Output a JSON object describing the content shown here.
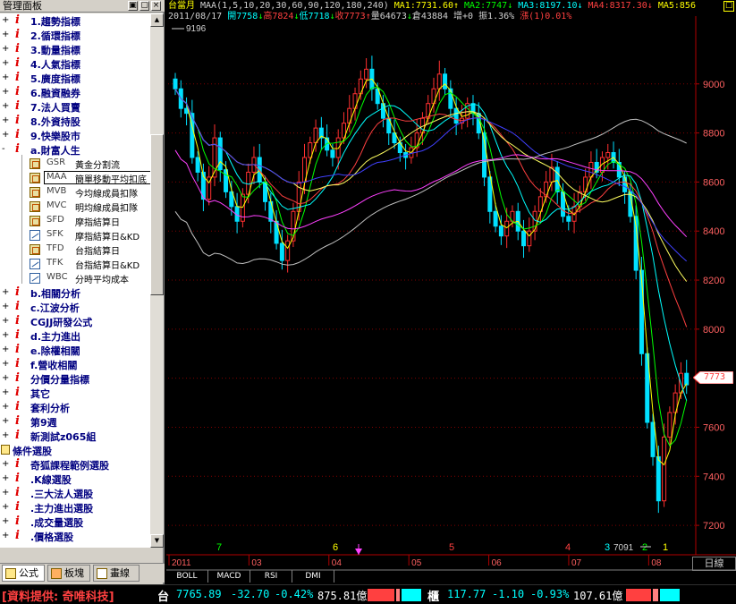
{
  "panel": {
    "title": "管理面板",
    "buttons": [
      "▣",
      "▢",
      "×"
    ],
    "items": [
      {
        "label": "1.趨勢指標",
        "kind": "i"
      },
      {
        "label": "2.循環指標",
        "kind": "i"
      },
      {
        "label": "3.動量指標",
        "kind": "i"
      },
      {
        "label": "4.人氣指標",
        "kind": "i"
      },
      {
        "label": "5.廣度指標",
        "kind": "i"
      },
      {
        "label": "6.融資融券",
        "kind": "i"
      },
      {
        "label": "7.法人買賣",
        "kind": "i"
      },
      {
        "label": "8.外資持股",
        "kind": "i"
      },
      {
        "label": "9.快樂股市",
        "kind": "i"
      },
      {
        "label": "a.財富人生",
        "kind": "i",
        "expanded": true
      },
      {
        "code": "GSR",
        "name": "黃金分割流",
        "kind": "sub",
        "icon": "formula"
      },
      {
        "code": "MAA",
        "name": "簡單移動平均扣底",
        "kind": "sub",
        "icon": "formula",
        "selected": true
      },
      {
        "code": "MVB",
        "name": "今均線成員扣隊",
        "kind": "sub",
        "icon": "formula"
      },
      {
        "code": "MVC",
        "name": "明均線成員扣隊",
        "kind": "sub",
        "icon": "formula"
      },
      {
        "code": "SFD",
        "name": "摩指結算日",
        "kind": "sub",
        "icon": "formula"
      },
      {
        "code": "SFK",
        "name": "摩指結算日&KD",
        "kind": "sub",
        "icon": "line"
      },
      {
        "code": "TFD",
        "name": "台指結算日",
        "kind": "sub",
        "icon": "formula"
      },
      {
        "code": "TFK",
        "name": "台指結算日&KD",
        "kind": "sub",
        "icon": "line"
      },
      {
        "code": "WBC",
        "name": "分時平均成本",
        "kind": "sub",
        "icon": "line"
      },
      {
        "label": "b.相關分析",
        "kind": "i"
      },
      {
        "label": "c.江波分析",
        "kind": "i"
      },
      {
        "label": "CGJJ研發公式",
        "kind": "i"
      },
      {
        "label": "d.主力進出",
        "kind": "i"
      },
      {
        "label": "e.除權相關",
        "kind": "i"
      },
      {
        "label": "f.營收相關",
        "kind": "i"
      },
      {
        "label": "分價分量指標",
        "kind": "i"
      },
      {
        "label": "其它",
        "kind": "i"
      },
      {
        "label": "套利分析",
        "kind": "i"
      },
      {
        "label": "第9週",
        "kind": "i"
      },
      {
        "label": "新測試z065組",
        "kind": "i"
      },
      {
        "label": "條件選股",
        "kind": "folder"
      },
      {
        "label": "奇狐課程範例選股",
        "kind": "i"
      },
      {
        "label": ".K線選股",
        "kind": "i"
      },
      {
        "label": ".三大法人選股",
        "kind": "i"
      },
      {
        "label": ".主力進出選股",
        "kind": "i"
      },
      {
        "label": ".成交量選股",
        "kind": "i"
      },
      {
        "label": ".價格選股",
        "kind": "i"
      }
    ],
    "tabs": [
      {
        "label": "公式",
        "active": true
      },
      {
        "label": "板塊",
        "active": false
      },
      {
        "label": "畫線",
        "active": false
      }
    ]
  },
  "chart_header": {
    "line1": [
      {
        "text": "台當月",
        "color": "#ffff00"
      },
      {
        "text": " MAA(1,5,10,20,30,60,90,120,180,240) ",
        "color": "#d0d0d0"
      },
      {
        "text": "MA1:7731.60↑",
        "color": "#ffff00"
      },
      {
        "text": " MA2:7747↓",
        "color": "#00ff00"
      },
      {
        "text": " MA3:8197.10↓",
        "color": "#00ffff"
      },
      {
        "text": " MA4:8317.30↓",
        "color": "#ff4040"
      },
      {
        "text": " MA5:856",
        "color": "#ffff00"
      }
    ],
    "line2": [
      {
        "text": "2011/08/17 ",
        "color": "#d0d0d0"
      },
      {
        "text": "開7758",
        "color": "#00ffff"
      },
      {
        "text": "↓",
        "color": "#00ff00"
      },
      {
        "text": "高7824",
        "color": "#ff4040"
      },
      {
        "text": "↓",
        "color": "#00ff00"
      },
      {
        "text": "低7718",
        "color": "#00ffff"
      },
      {
        "text": "↓",
        "color": "#00ff00"
      },
      {
        "text": "收7773",
        "color": "#ff4040"
      },
      {
        "text": "↑",
        "color": "#ff4040"
      },
      {
        "text": "量64673",
        "color": "#d0d0d0"
      },
      {
        "text": "↓",
        "color": "#00ff00"
      },
      {
        "text": "倉43884 ",
        "color": "#d0d0d0"
      },
      {
        "text": "增+0 ",
        "color": "#d0d0d0"
      },
      {
        "text": "振1.36% ",
        "color": "#d0d0d0"
      },
      {
        "text": "漲(1)0.01%",
        "color": "#ff4040"
      }
    ],
    "close_icon": "☐"
  },
  "chart_data": {
    "type": "candlestick",
    "title": "台當月",
    "indicator": "MAA(1,5,10,20,30,60,90,120,180,240)",
    "y_ticks": [
      7200,
      7400,
      7600,
      7800,
      8000,
      8200,
      8400,
      8600,
      8800,
      9000
    ],
    "ylim": [
      7080,
      9240
    ],
    "x_labels": [
      "2011",
      "03",
      "04",
      "05",
      "06",
      "07",
      "08"
    ],
    "marks": {
      "high_label": "9196",
      "low_label": "7091",
      "last_price": "7773"
    },
    "wave_labels": [
      "7",
      "6",
      "5",
      "4",
      "3",
      "2",
      "1"
    ],
    "close_series": [
      8980,
      8900,
      8880,
      8700,
      8640,
      8530,
      8620,
      8780,
      8650,
      8560,
      8500,
      8440,
      8550,
      8640,
      8700,
      8600,
      8520,
      8440,
      8350,
      8280,
      8360,
      8480,
      8600,
      8700,
      8760,
      8820,
      8780,
      8730,
      8700,
      8780,
      8840,
      8900,
      8960,
      9020,
      9060,
      8980,
      8920,
      8860,
      8800,
      8760,
      8720,
      8700,
      8740,
      8800,
      8860,
      8920,
      8980,
      9040,
      8980,
      8900,
      8840,
      8860,
      8920,
      8880,
      8800,
      8620,
      8480,
      8420,
      8380,
      8440,
      8480,
      8400,
      8340,
      8400,
      8480,
      8540,
      8600,
      8660,
      8560,
      8460,
      8440,
      8500,
      8560,
      8620,
      8680,
      8640,
      8700,
      8720,
      8680,
      8620,
      8560,
      8460,
      8240,
      7900,
      7620,
      7480,
      7300,
      7560,
      7660,
      7740,
      7820,
      7773
    ],
    "ma": [
      {
        "name": "MA1",
        "color": "#ffff00",
        "value": "7731.60"
      },
      {
        "name": "MA2",
        "color": "#00ff00",
        "value": "7747"
      },
      {
        "name": "MA3",
        "color": "#00ffff",
        "value": "8197.10"
      },
      {
        "name": "MA4",
        "color": "#ff4040",
        "value": "8317.30"
      },
      {
        "name": "MA5",
        "color": "#ffff00",
        "value": "856"
      }
    ],
    "indicator_tabs": [
      "BOLL",
      "MACD",
      "RSI",
      "DMI"
    ],
    "period_button": "日線",
    "colors": {
      "up": "#ff3030",
      "down": "#00e0ff",
      "grid": "#800000",
      "axis": "#b00000"
    }
  },
  "ticker": {
    "source": "[資料提供: 奇唯科技]",
    "taiex": {
      "symbol": "台",
      "price": "7765.89",
      "change": "-32.70",
      "pct": "-0.42%",
      "volume": "875.81億"
    },
    "otc": {
      "symbol": "櫃",
      "price": "117.77",
      "change": "-1.10",
      "pct": "-0.93%",
      "volume": "107.61億"
    }
  }
}
